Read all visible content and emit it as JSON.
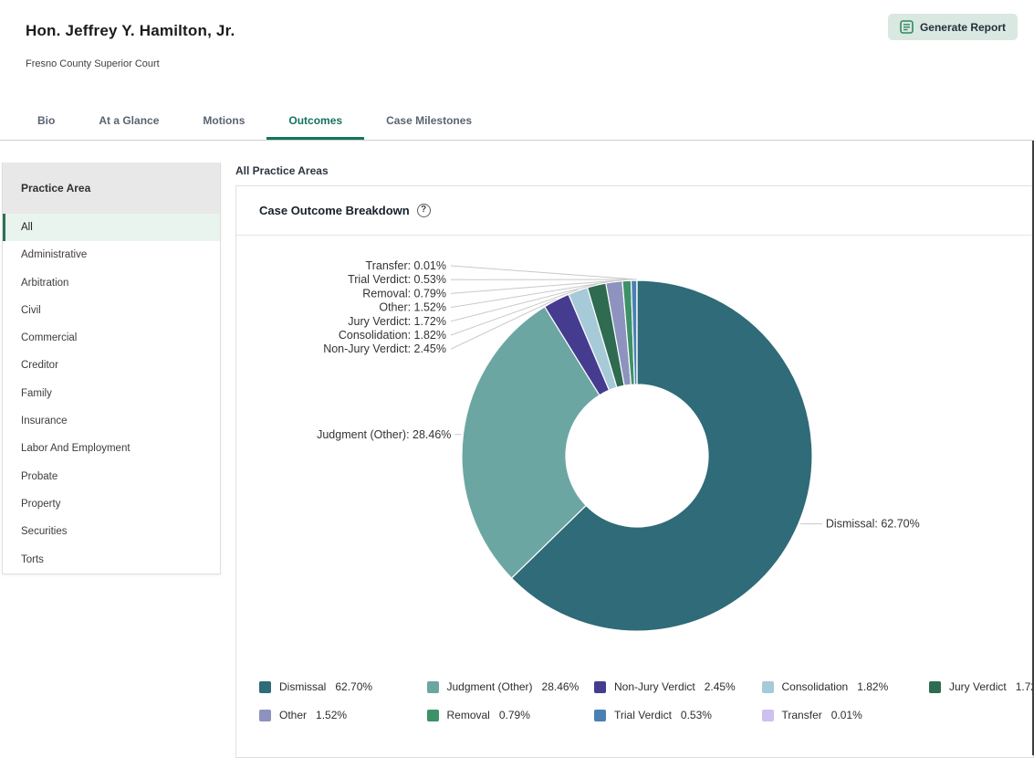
{
  "header": {
    "title": "Hon. Jeffrey Y. Hamilton, Jr.",
    "subtitle": "Fresno County Superior Court",
    "generate_report_label": "Generate Report"
  },
  "tabs": [
    {
      "label": "Bio",
      "active": false
    },
    {
      "label": "At a Glance",
      "active": false
    },
    {
      "label": "Motions",
      "active": false
    },
    {
      "label": "Outcomes",
      "active": true
    },
    {
      "label": "Case Milestones",
      "active": false
    }
  ],
  "sidebar": {
    "title": "Practice Area",
    "items": [
      {
        "label": "All",
        "active": true
      },
      {
        "label": "Administrative",
        "active": false
      },
      {
        "label": "Arbitration",
        "active": false
      },
      {
        "label": "Civil",
        "active": false
      },
      {
        "label": "Commercial",
        "active": false
      },
      {
        "label": "Creditor",
        "active": false
      },
      {
        "label": "Family",
        "active": false
      },
      {
        "label": "Insurance",
        "active": false
      },
      {
        "label": "Labor And Employment",
        "active": false
      },
      {
        "label": "Probate",
        "active": false
      },
      {
        "label": "Property",
        "active": false
      },
      {
        "label": "Securities",
        "active": false
      },
      {
        "label": "Torts",
        "active": false
      }
    ]
  },
  "main": {
    "breadcrumb": "All Practice Areas",
    "card_title": "Case Outcome Breakdown",
    "help_icon": "?"
  },
  "chart_data": {
    "type": "pie",
    "donut": true,
    "title": "Case Outcome Breakdown",
    "legend_position": "bottom",
    "slices": [
      {
        "label": "Dismissal",
        "value": 62.7,
        "display": "62.70%",
        "color": "#2f6b78"
      },
      {
        "label": "Judgment (Other)",
        "value": 28.46,
        "display": "28.46%",
        "color": "#6ba6a3"
      },
      {
        "label": "Non-Jury Verdict",
        "value": 2.45,
        "display": "2.45%",
        "color": "#463c8f"
      },
      {
        "label": "Consolidation",
        "value": 1.82,
        "display": "1.82%",
        "color": "#a6cad8"
      },
      {
        "label": "Jury Verdict",
        "value": 1.72,
        "display": "1.72%",
        "color": "#2e6b51"
      },
      {
        "label": "Other",
        "value": 1.52,
        "display": "1.52%",
        "color": "#8d93be"
      },
      {
        "label": "Removal",
        "value": 0.79,
        "display": "0.79%",
        "color": "#3d9166"
      },
      {
        "label": "Trial Verdict",
        "value": 0.53,
        "display": "0.53%",
        "color": "#4b80b4"
      },
      {
        "label": "Transfer",
        "value": 0.01,
        "display": "0.01%",
        "color": "#ccc1ee"
      }
    ]
  }
}
